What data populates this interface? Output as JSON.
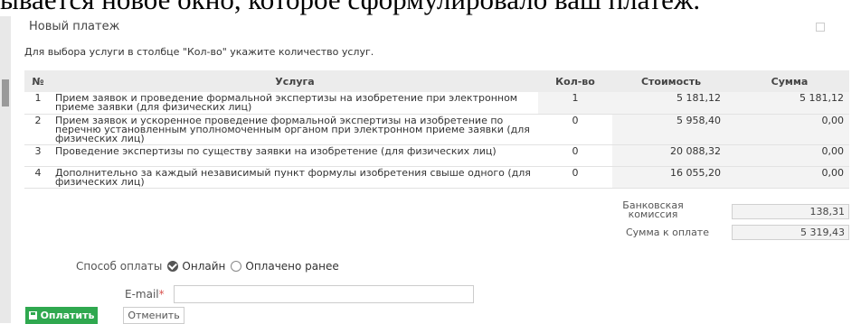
{
  "background_text": "ывается новое окно, которое сформулировало ваш платеж.",
  "dialog": {
    "title": "Новый платеж",
    "hint": "Для выбора услуги в столбце \"Кол-во\" укажите количество услуг."
  },
  "table": {
    "headers": {
      "num": "№",
      "service": "Услуга",
      "qty": "Кол-во",
      "cost": "Стоимость",
      "sum": "Сумма"
    },
    "rows": [
      {
        "num": "1",
        "service": "Прием заявок и проведение формальной экспертизы на изобретение при электронном приеме заявки (для физических лиц)",
        "qty": "1",
        "cost": "5 181,12",
        "sum": "5 181,12"
      },
      {
        "num": "2",
        "service": "Прием заявок и ускоренное проведение формальной экспертизы на изобретение по перечню установленным уполномоченным органом при электронном приеме заявки (для физических лиц)",
        "qty": "0",
        "cost": "5 958,40",
        "sum": "0,00"
      },
      {
        "num": "3",
        "service": "Проведение экспертизы по существу заявки на изобретение  (для физических лиц)",
        "qty": "0",
        "cost": "20 088,32",
        "sum": "0,00"
      },
      {
        "num": "4",
        "service": "Дополнительно за каждый независимый пункт формулы изобретения свыше одного (для физических лиц)",
        "qty": "0",
        "cost": "16 055,20",
        "sum": "0,00"
      }
    ]
  },
  "totals": {
    "commission_label_1": "Банковская",
    "commission_label_2": "комиссия",
    "commission_value": "138,31",
    "total_label": "Сумма к оплате",
    "total_value": "5 319,43"
  },
  "payment": {
    "label": "Способ оплаты",
    "option_online": "Онлайн",
    "option_paid": "Оплачено ранее",
    "selected": "Онлайн"
  },
  "email": {
    "label": "E-mail",
    "required_mark": "*",
    "value": ""
  },
  "buttons": {
    "pay": "Оплатить",
    "cancel": "Отменить"
  },
  "colors": {
    "pay_button": "#2fa84f",
    "header_bg": "#ececec",
    "required": "#d9534f"
  }
}
